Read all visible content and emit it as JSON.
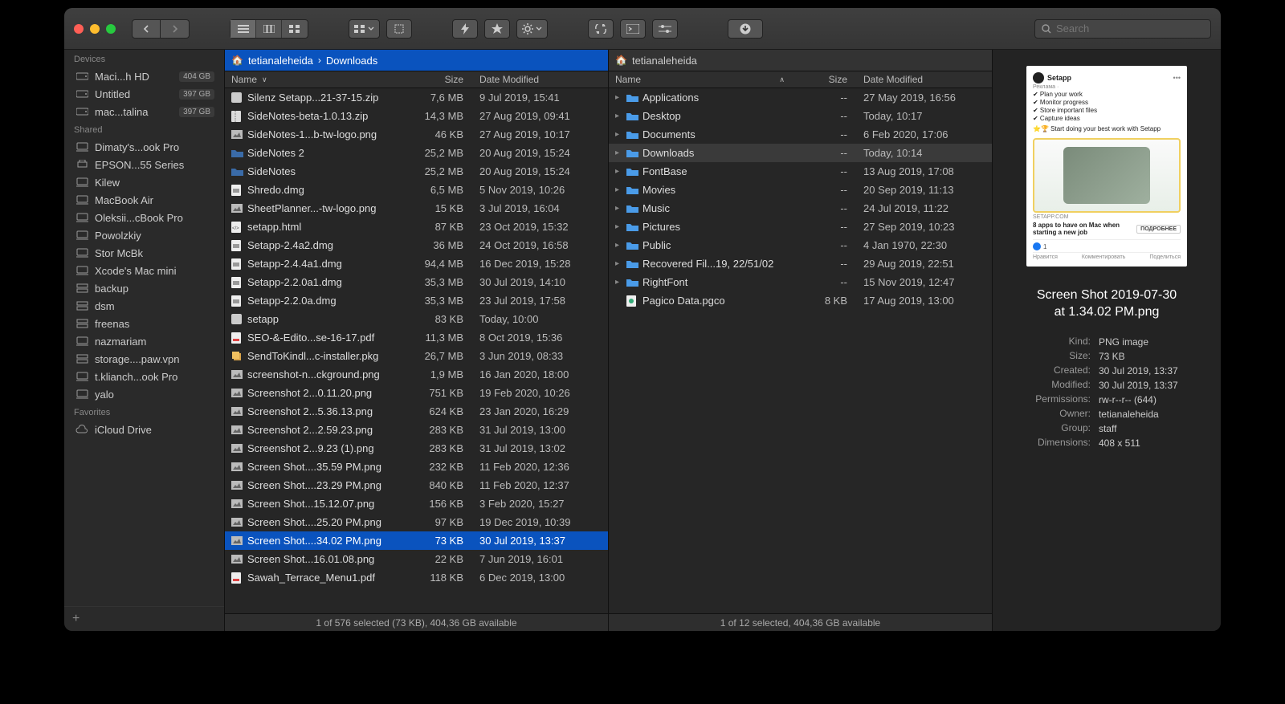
{
  "toolbar": {
    "search_placeholder": "Search"
  },
  "sidebar": {
    "sections": [
      {
        "header": "Devices",
        "items": [
          {
            "icon": "hdd",
            "label": "Maci...h HD",
            "badge": "404 GB"
          },
          {
            "icon": "hdd",
            "label": "Untitled",
            "badge": "397 GB"
          },
          {
            "icon": "hdd",
            "label": "mac...talina",
            "badge": "397 GB"
          }
        ]
      },
      {
        "header": "Shared",
        "items": [
          {
            "icon": "computer",
            "label": "Dimaty's...ook Pro"
          },
          {
            "icon": "printer",
            "label": "EPSON...55 Series"
          },
          {
            "icon": "computer",
            "label": "Kilew"
          },
          {
            "icon": "computer",
            "label": "MacBook Air"
          },
          {
            "icon": "computer",
            "label": "Oleksii...cBook Pro"
          },
          {
            "icon": "computer",
            "label": "Powolzkiy"
          },
          {
            "icon": "computer",
            "label": "Stor McBk"
          },
          {
            "icon": "computer",
            "label": "Xcode's Mac mini"
          },
          {
            "icon": "nas",
            "label": "backup"
          },
          {
            "icon": "nas",
            "label": "dsm"
          },
          {
            "icon": "nas",
            "label": "freenas"
          },
          {
            "icon": "computer",
            "label": "nazmariam"
          },
          {
            "icon": "nas",
            "label": "storage....paw.vpn"
          },
          {
            "icon": "computer",
            "label": "t.klianch...ook Pro"
          },
          {
            "icon": "computer",
            "label": "yalo"
          }
        ]
      },
      {
        "header": "Favorites",
        "items": [
          {
            "icon": "cloud",
            "label": "iCloud Drive"
          }
        ]
      }
    ]
  },
  "pane1": {
    "path": [
      "tetianaleheida",
      "Downloads"
    ],
    "columns": {
      "name": "Name",
      "size": "Size",
      "date": "Date Modified",
      "sort": "down"
    },
    "rows": [
      {
        "icon": "app",
        "name": "Silenz Setapp...21-37-15.zip",
        "size": "7,6 MB",
        "date": "9 Jul 2019, 15:41"
      },
      {
        "icon": "zip",
        "name": "SideNotes-beta-1.0.13.zip",
        "size": "14,3 MB",
        "date": "27 Aug 2019, 09:41"
      },
      {
        "icon": "png",
        "name": "SideNotes-1...b-tw-logo.png",
        "size": "46 KB",
        "date": "27 Aug 2019, 10:17"
      },
      {
        "icon": "folder-b",
        "name": "SideNotes 2",
        "size": "25,2 MB",
        "date": "20 Aug 2019, 15:24"
      },
      {
        "icon": "folder-b",
        "name": "SideNotes",
        "size": "25,2 MB",
        "date": "20 Aug 2019, 15:24"
      },
      {
        "icon": "dmg",
        "name": "Shredo.dmg",
        "size": "6,5 MB",
        "date": "5 Nov 2019, 10:26"
      },
      {
        "icon": "png",
        "name": "SheetPlanner...-tw-logo.png",
        "size": "15 KB",
        "date": "3 Jul 2019, 16:04"
      },
      {
        "icon": "html",
        "name": "setapp.html",
        "size": "87 KB",
        "date": "23 Oct 2019, 15:32"
      },
      {
        "icon": "dmg",
        "name": "Setapp-2.4a2.dmg",
        "size": "36 MB",
        "date": "24 Oct 2019, 16:58"
      },
      {
        "icon": "dmg",
        "name": "Setapp-2.4.4a1.dmg",
        "size": "94,4 MB",
        "date": "16 Dec 2019, 15:28"
      },
      {
        "icon": "dmg",
        "name": "Setapp-2.2.0a1.dmg",
        "size": "35,3 MB",
        "date": "30 Jul 2019, 14:10"
      },
      {
        "icon": "dmg",
        "name": "Setapp-2.2.0a.dmg",
        "size": "35,3 MB",
        "date": "23 Jul 2019, 17:58"
      },
      {
        "icon": "app",
        "name": "setapp",
        "size": "83 KB",
        "date": "Today, 10:00"
      },
      {
        "icon": "pdf",
        "name": "SEO-&-Edito...se-16-17.pdf",
        "size": "11,3 MB",
        "date": "8 Oct 2019, 15:36"
      },
      {
        "icon": "pkg",
        "name": "SendToKindl...c-installer.pkg",
        "size": "26,7 MB",
        "date": "3 Jun 2019, 08:33"
      },
      {
        "icon": "png",
        "name": "screenshot-n...ckground.png",
        "size": "1,9 MB",
        "date": "16 Jan 2020, 18:00"
      },
      {
        "icon": "png",
        "name": "Screenshot 2...0.11.20.png",
        "size": "751 KB",
        "date": "19 Feb 2020, 10:26"
      },
      {
        "icon": "png",
        "name": "Screenshot 2...5.36.13.png",
        "size": "624 KB",
        "date": "23 Jan 2020, 16:29"
      },
      {
        "icon": "png",
        "name": "Screenshot 2...2.59.23.png",
        "size": "283 KB",
        "date": "31 Jul 2019, 13:00"
      },
      {
        "icon": "png",
        "name": "Screenshot 2...9.23 (1).png",
        "size": "283 KB",
        "date": "31 Jul 2019, 13:02"
      },
      {
        "icon": "png",
        "name": "Screen Shot....35.59 PM.png",
        "size": "232 KB",
        "date": "11 Feb 2020, 12:36"
      },
      {
        "icon": "png",
        "name": "Screen Shot....23.29 PM.png",
        "size": "840 KB",
        "date": "11 Feb 2020, 12:37"
      },
      {
        "icon": "png",
        "name": "Screen Shot...15.12.07.png",
        "size": "156 KB",
        "date": "3 Feb 2020, 15:27"
      },
      {
        "icon": "png",
        "name": "Screen Shot....25.20 PM.png",
        "size": "97 KB",
        "date": "19 Dec 2019, 10:39"
      },
      {
        "icon": "png",
        "name": "Screen Shot....34.02 PM.png",
        "size": "73 KB",
        "date": "30 Jul 2019, 13:37",
        "selected": true
      },
      {
        "icon": "png",
        "name": "Screen Shot...16.01.08.png",
        "size": "22 KB",
        "date": "7 Jun 2019, 16:01"
      },
      {
        "icon": "pdf",
        "name": "Sawah_Terrace_Menu1.pdf",
        "size": "118 KB",
        "date": "6 Dec 2019, 13:00"
      }
    ],
    "status": "1 of 576 selected (73 KB), 404,36 GB available"
  },
  "pane2": {
    "path": [
      "tetianaleheida"
    ],
    "columns": {
      "name": "Name",
      "size": "Size",
      "date": "Date Modified",
      "sort": "up"
    },
    "rows": [
      {
        "disclose": true,
        "icon": "folder",
        "name": "Applications",
        "size": "--",
        "date": "27 May 2019, 16:56"
      },
      {
        "disclose": true,
        "icon": "folder",
        "name": "Desktop",
        "size": "--",
        "date": "Today, 10:17"
      },
      {
        "disclose": true,
        "icon": "folder",
        "name": "Documents",
        "size": "--",
        "date": "6 Feb 2020, 17:06"
      },
      {
        "disclose": true,
        "icon": "folder",
        "name": "Downloads",
        "size": "--",
        "date": "Today, 10:14",
        "highlight": true
      },
      {
        "disclose": true,
        "icon": "folder",
        "name": "FontBase",
        "size": "--",
        "date": "13 Aug 2019, 17:08"
      },
      {
        "disclose": true,
        "icon": "folder",
        "name": "Movies",
        "size": "--",
        "date": "20 Sep 2019, 11:13"
      },
      {
        "disclose": true,
        "icon": "folder",
        "name": "Music",
        "size": "--",
        "date": "24 Jul 2019, 11:22"
      },
      {
        "disclose": true,
        "icon": "folder",
        "name": "Pictures",
        "size": "--",
        "date": "27 Sep 2019, 10:23"
      },
      {
        "disclose": true,
        "icon": "folder",
        "name": "Public",
        "size": "--",
        "date": "4 Jan 1970, 22:30"
      },
      {
        "disclose": true,
        "icon": "folder",
        "name": "Recovered Fil...19, 22/51/02",
        "size": "--",
        "date": "29 Aug 2019, 22:51"
      },
      {
        "disclose": true,
        "icon": "folder",
        "name": "RightFont",
        "size": "--",
        "date": "15 Nov 2019, 12:47"
      },
      {
        "disclose": false,
        "icon": "doc",
        "name": "Pagico Data.pgco",
        "size": "8 KB",
        "date": "17 Aug 2019, 13:00"
      }
    ],
    "status": "1 of 12 selected, 404,36 GB available"
  },
  "preview": {
    "ad": {
      "brand": "Setapp",
      "subtitle": "Реклама ·",
      "lines": [
        "✔ Plan your work",
        "✔ Monitor progress",
        "✔ Store important files",
        "✔ Capture ideas"
      ],
      "star_line": "⭐🏆 Start doing your best work with Setapp",
      "domain": "SETAPP.COM",
      "headline": "8 apps to have on Mac when starting a new job",
      "cta": "ПОДРОБНЕЕ",
      "like_count": "1",
      "actions": [
        "Нравится",
        "Комментировать",
        "Поделиться"
      ]
    },
    "title_line1": "Screen Shot 2019-07-30",
    "title_line2": "at 1.34.02 PM.png",
    "meta": {
      "kind_label": "Kind:",
      "kind": "PNG image",
      "size_label": "Size:",
      "size": "73 KB",
      "created_label": "Created:",
      "created": "30 Jul 2019, 13:37",
      "modified_label": "Modified:",
      "modified": "30 Jul 2019, 13:37",
      "perm_label": "Permissions:",
      "perm": "rw-r--r-- (644)",
      "owner_label": "Owner:",
      "owner": "tetianaleheida",
      "group_label": "Group:",
      "group": "staff",
      "dim_label": "Dimensions:",
      "dim": "408 x 511"
    }
  }
}
